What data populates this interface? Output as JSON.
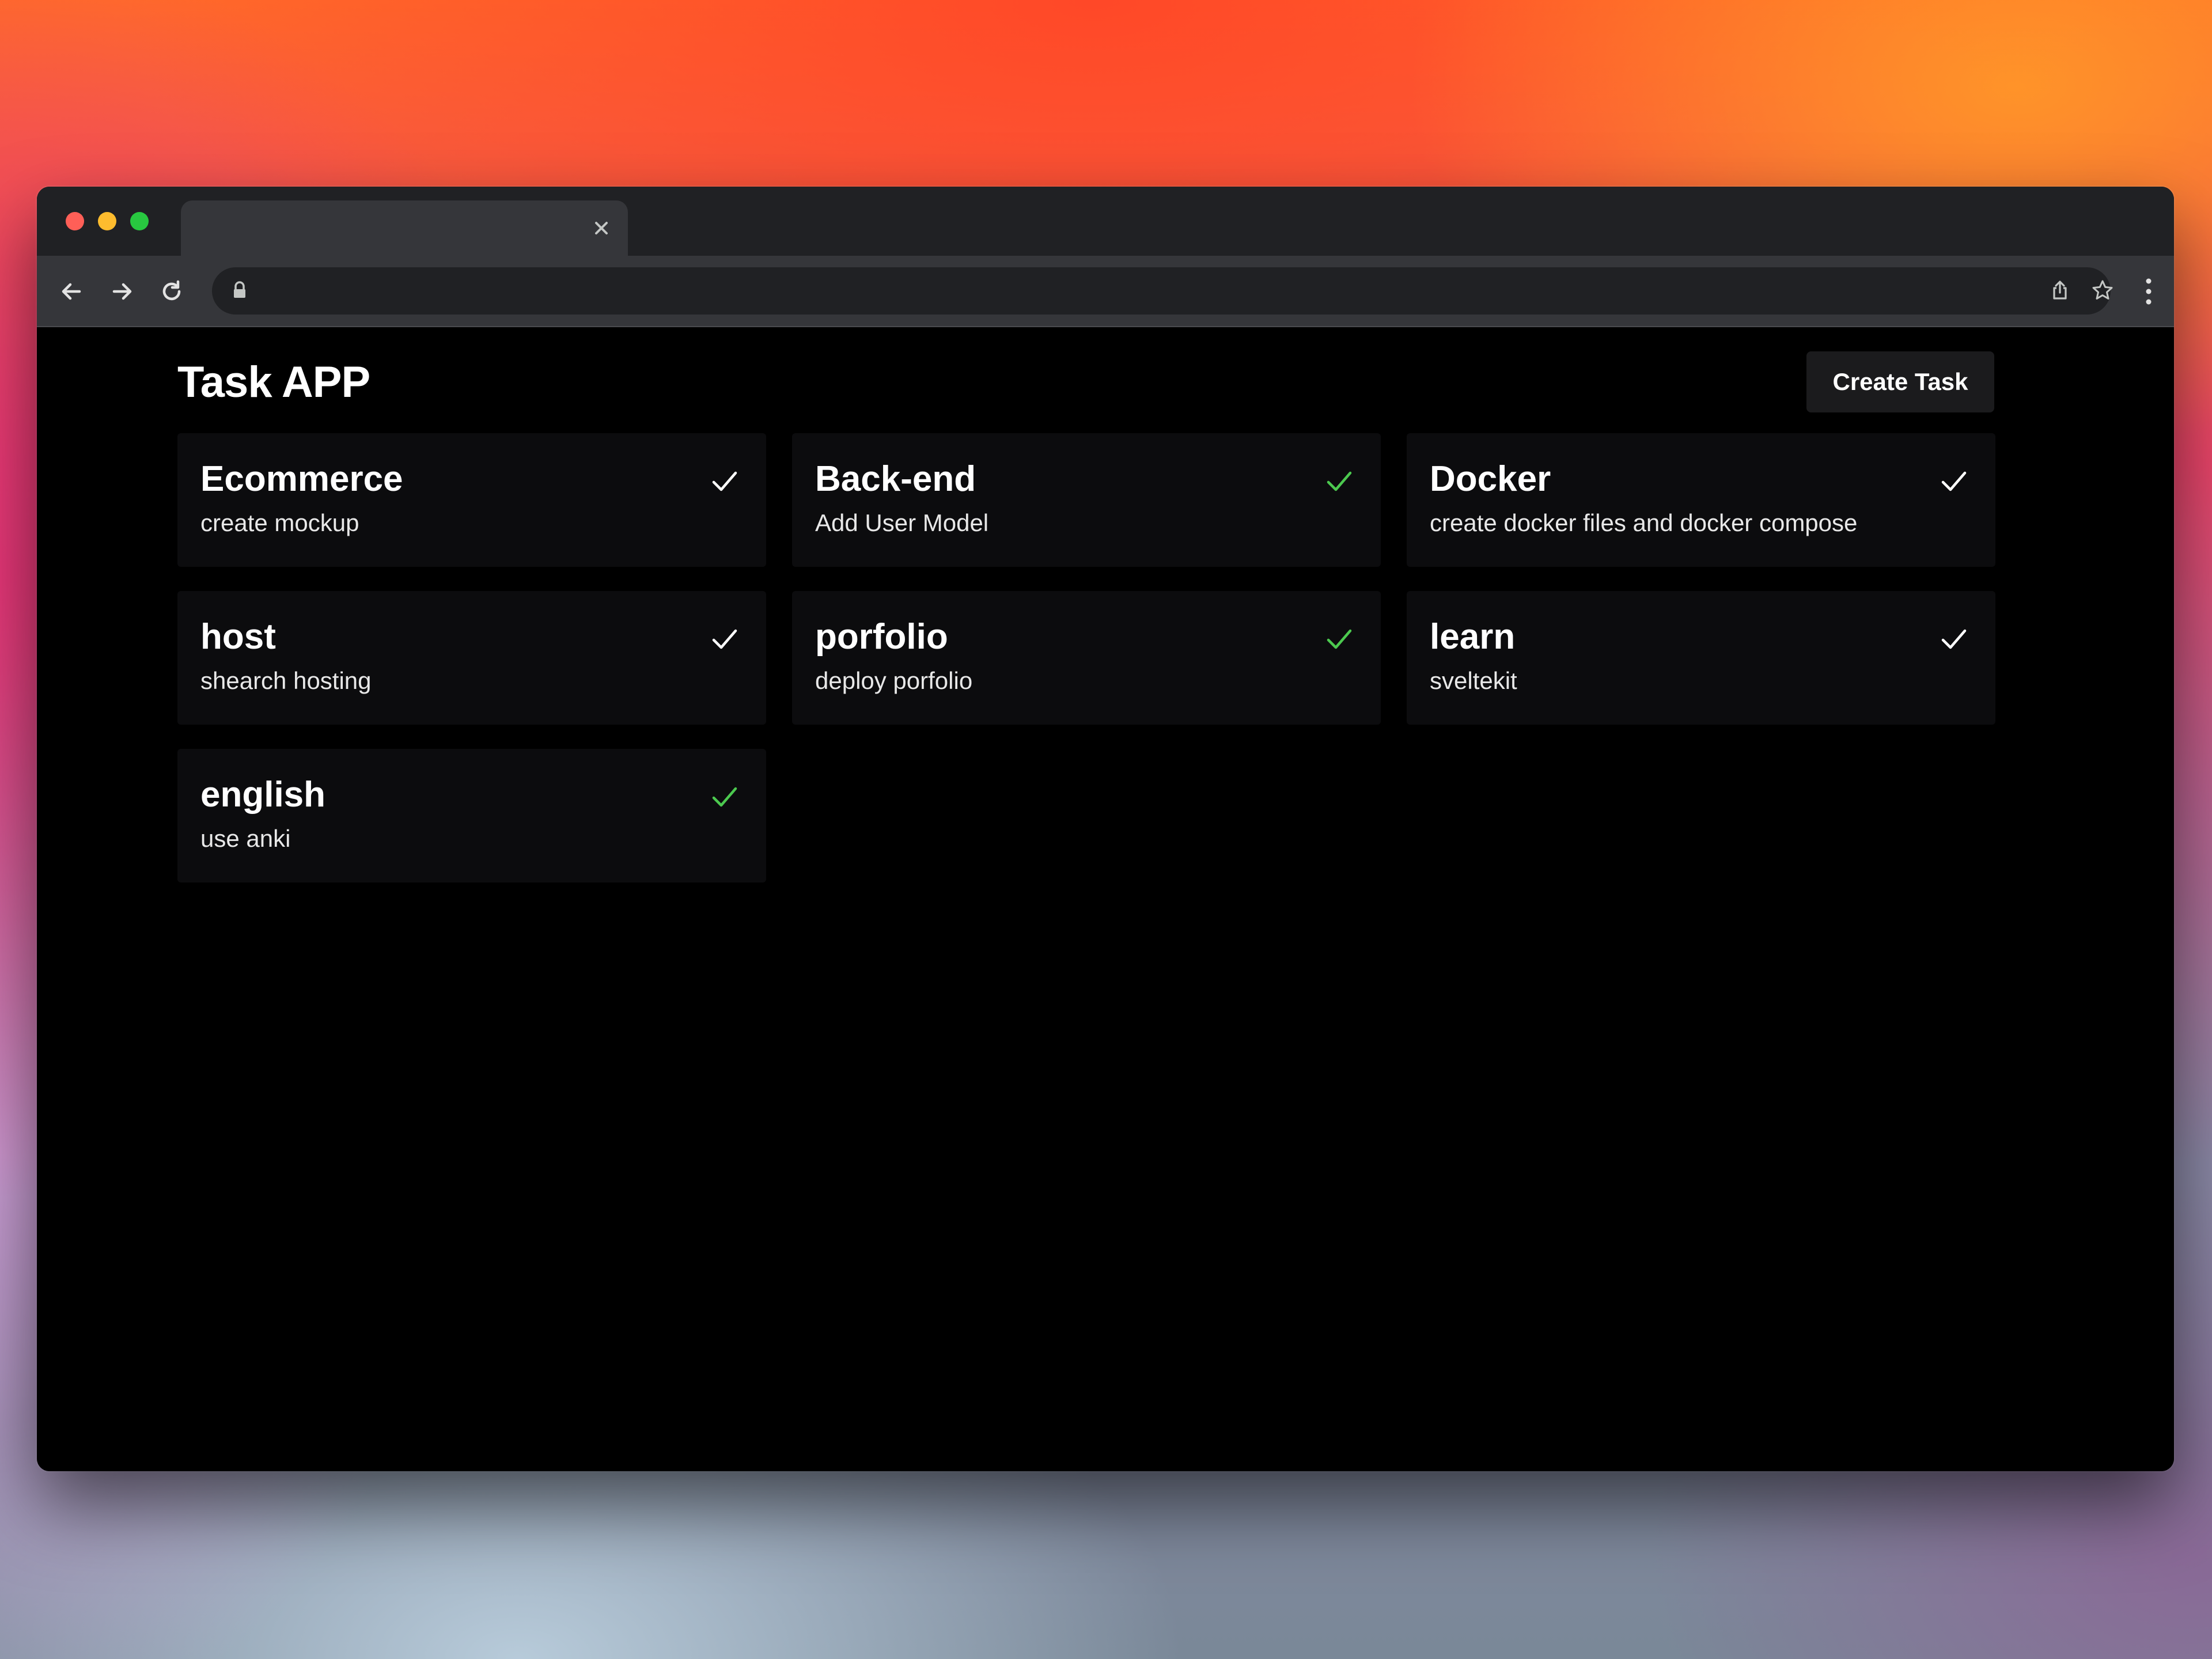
{
  "app": {
    "title": "Task APP",
    "create_button_label": "Create Task"
  },
  "tasks": [
    {
      "title": "Ecommerce",
      "description": "create mockup",
      "check_color": "#ffffff"
    },
    {
      "title": "Back-end",
      "description": "Add User Model",
      "check_color": "#4cc94f"
    },
    {
      "title": "Docker",
      "description": "create docker files and docker compose",
      "check_color": "#ffffff"
    },
    {
      "title": "host",
      "description": "shearch hosting",
      "check_color": "#ffffff"
    },
    {
      "title": "porfolio",
      "description": "deploy porfolio",
      "check_color": "#4cc94f"
    },
    {
      "title": "learn",
      "description": "sveltekit",
      "check_color": "#ffffff"
    },
    {
      "title": "english",
      "description": "use anki",
      "check_color": "#4cc94f"
    }
  ],
  "icons": {
    "check": "check-icon",
    "window_controls": [
      "close-dot",
      "minimize-dot",
      "zoom-dot"
    ],
    "toolbar": [
      "back-arrow-icon",
      "forward-arrow-icon",
      "reload-icon",
      "lock-icon",
      "share-icon",
      "star-icon",
      "more-menu-icon"
    ]
  },
  "colors": {
    "page_background": "#000000",
    "card_background": "#0c0c0e",
    "button_background": "#1b1b1d",
    "accent_green": "#4cc94f",
    "text_primary": "#ffffff"
  }
}
